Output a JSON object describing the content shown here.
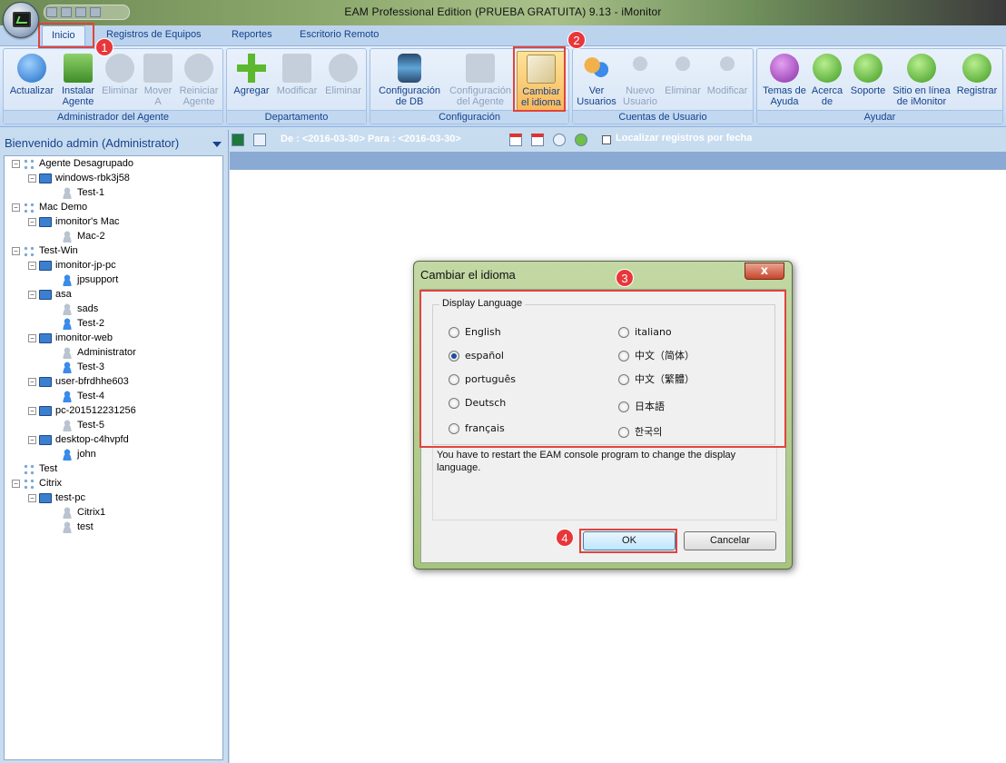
{
  "window": {
    "title": "EAM Professional Edition (PRUEBA GRATUITA) 9.13 - iMonitor"
  },
  "tabs": [
    {
      "label": "Inicio"
    },
    {
      "label": "Registros de Equipos"
    },
    {
      "label": "Reportes"
    },
    {
      "label": "Escritorio Remoto"
    }
  ],
  "ribbon": {
    "groups": [
      {
        "label": "Administrador del Agente",
        "buttons": [
          "Actualizar",
          "Instalar Agente",
          "Eliminar",
          "Mover A",
          "Reiniciar Agente"
        ]
      },
      {
        "label": "Departamento",
        "buttons": [
          "Agregar",
          "Modificar",
          "Eliminar"
        ]
      },
      {
        "label": "Configuración",
        "buttons": [
          "Configuración de DB",
          "Configuración del Agente",
          "Cambiar el idioma"
        ]
      },
      {
        "label": "Cuentas de Usuario",
        "buttons": [
          "Ver Usuarios",
          "Nuevo Usuario",
          "Eliminar",
          "Modificar"
        ]
      },
      {
        "label": "Ayudar",
        "buttons": [
          "Temas de Ayuda",
          "Acerca de",
          "Soporte",
          "Sitio en línea de iMonitor",
          "Registrar"
        ]
      }
    ],
    "btn": {
      "actualizar": "Actualizar",
      "instalar1": "Instalar",
      "instalar2": "Agente",
      "eliminar": "Eliminar",
      "mover1": "Mover",
      "mover2": "A",
      "reiniciar1": "Reiniciar",
      "reiniciar2": "Agente",
      "agregar": "Agregar",
      "modificar": "Modificar",
      "eliminar2": "Eliminar",
      "confdb1": "Configuración",
      "confdb2": "de DB",
      "confag1": "Configuración",
      "confag2": "del Agente",
      "cambiar1": "Cambiar",
      "cambiar2": "el idioma",
      "ver1": "Ver",
      "ver2": "Usuarios",
      "nuevo1": "Nuevo",
      "nuevo2": "Usuario",
      "eliminar3": "Eliminar",
      "modificar2": "Modificar",
      "temas1": "Temas de",
      "temas2": "Ayuda",
      "acerca1": "Acerca",
      "acerca2": "de",
      "soporte": "Soporte",
      "sitio1": "Sitio en línea",
      "sitio2": "de iMonitor",
      "registrar": "Registrar"
    }
  },
  "badges": [
    "1",
    "2",
    "3",
    "4"
  ],
  "sidebar": {
    "header": "Bienvenido admin (Administrator)",
    "tree": [
      {
        "label": "Agente Desagrupado",
        "type": "group"
      },
      {
        "label": "windows-rbk3j58",
        "type": "pc"
      },
      {
        "label": "Test-1",
        "type": "user"
      },
      {
        "label": "Mac Demo",
        "type": "group"
      },
      {
        "label": "imonitor's Mac",
        "type": "pc"
      },
      {
        "label": "Mac-2",
        "type": "user"
      },
      {
        "label": "Test-Win",
        "type": "group"
      },
      {
        "label": "imonitor-jp-pc",
        "type": "pc"
      },
      {
        "label": "jpsupport",
        "type": "user-active"
      },
      {
        "label": "asa",
        "type": "pc"
      },
      {
        "label": "sads",
        "type": "user"
      },
      {
        "label": "Test-2",
        "type": "user-active"
      },
      {
        "label": "imonitor-web",
        "type": "pc"
      },
      {
        "label": "Administrator",
        "type": "user"
      },
      {
        "label": "Test-3",
        "type": "user-active"
      },
      {
        "label": "user-bfrdhhe603",
        "type": "pc"
      },
      {
        "label": "Test-4",
        "type": "user-active"
      },
      {
        "label": "pc-201512231256",
        "type": "pc"
      },
      {
        "label": "Test-5",
        "type": "user"
      },
      {
        "label": "desktop-c4hvpfd",
        "type": "pc"
      },
      {
        "label": "john",
        "type": "user-active"
      },
      {
        "label": "Test",
        "type": "group"
      },
      {
        "label": "Citrix",
        "type": "group"
      },
      {
        "label": "test-pc",
        "type": "pc"
      },
      {
        "label": "Citrix1",
        "type": "user"
      },
      {
        "label": "test",
        "type": "user"
      }
    ]
  },
  "filterbar": {
    "date_range": "De : <2016-03-30> Para : <2016-03-30>",
    "locate_label": "Localizar registros por fecha"
  },
  "dialog": {
    "title": "Cambiar el idioma",
    "close": "x",
    "group_label": "Display Language",
    "languages": [
      "English",
      "español",
      "português",
      "Deutsch",
      "français",
      "italiano",
      "中文（简体）",
      "中文（繁體）",
      "日本語",
      "한국의"
    ],
    "selected": "español",
    "message": "You have to restart the EAM console program to change the display language.",
    "ok": "OK",
    "cancel": "Cancelar"
  },
  "colors": {
    "highlight": "#e0443c",
    "ribbon": "#d0e1f5",
    "dialog_frame": "#a7c47e"
  }
}
